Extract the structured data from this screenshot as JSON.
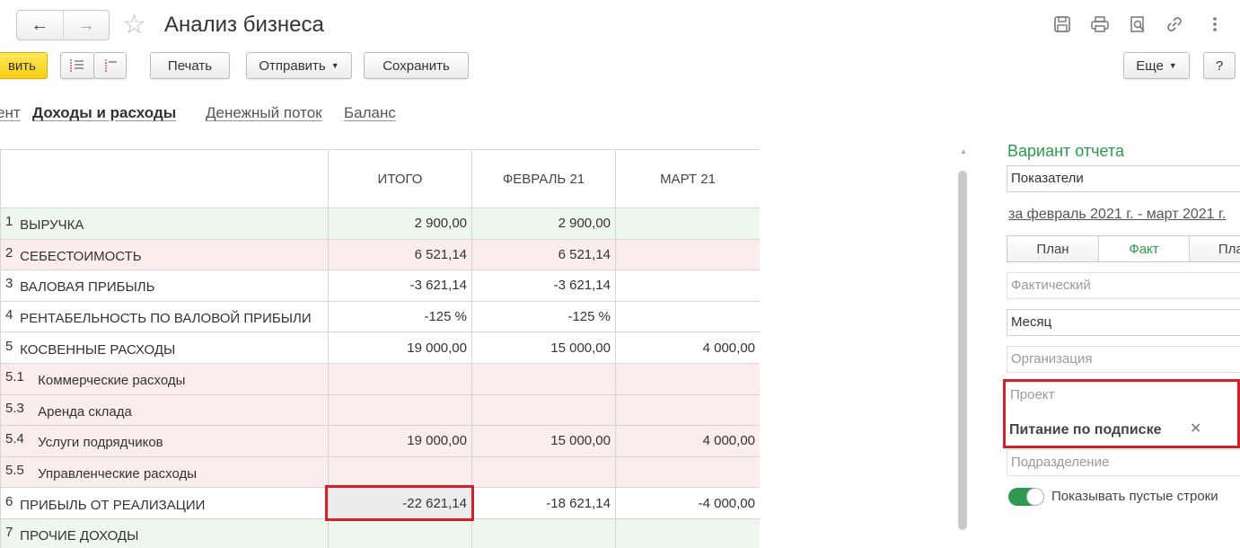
{
  "header": {
    "back_icon": "←",
    "forward_icon": "→",
    "favorite_icon": "☆",
    "title": "Анализ бизнеса"
  },
  "toolbar": {
    "primary_label": "вить",
    "print_label": "Печать",
    "send_label": "Отправить",
    "save_label": "Сохранить",
    "more_label": "Еще",
    "help_label": "?"
  },
  "tabs": [
    {
      "label": "ент"
    },
    {
      "label": "Доходы и расходы"
    },
    {
      "label": "Денежный поток"
    },
    {
      "label": "Баланс"
    }
  ],
  "table": {
    "columns": [
      "ИТОГО",
      "ФЕВРАЛЬ 21",
      "МАРТ 21"
    ],
    "rows": [
      {
        "num": "1",
        "name": "ВЫРУЧКА",
        "total": "2 900,00",
        "feb": "2 900,00",
        "mar": ""
      },
      {
        "num": "2",
        "name": "СЕБЕСТОИМОСТЬ",
        "total": "6 521,14",
        "feb": "6 521,14",
        "mar": ""
      },
      {
        "num": "3",
        "name": "ВАЛОВАЯ ПРИБЫЛЬ",
        "total": "-3 621,14",
        "feb": "-3 621,14",
        "mar": ""
      },
      {
        "num": "4",
        "name": "РЕНТАБЕЛЬНОСТЬ ПО ВАЛОВОЙ ПРИБЫЛИ",
        "total": "-125 %",
        "feb": "-125 %",
        "mar": ""
      },
      {
        "num": "5",
        "name": "КОСВЕННЫЕ РАСХОДЫ",
        "total": "19 000,00",
        "feb": "15 000,00",
        "mar": "4 000,00"
      },
      {
        "num": "5.1",
        "name": "Коммерческие расходы",
        "total": "",
        "feb": "",
        "mar": ""
      },
      {
        "num": "5.3",
        "name": "Аренда склада",
        "total": "",
        "feb": "",
        "mar": ""
      },
      {
        "num": "5.4",
        "name": "Услуги подрядчиков",
        "total": "19 000,00",
        "feb": "15 000,00",
        "mar": "4 000,00"
      },
      {
        "num": "5.5",
        "name": "Управленческие расходы",
        "total": "",
        "feb": "",
        "mar": ""
      },
      {
        "num": "6",
        "name": "ПРИБЫЛЬ ОТ РЕАЛИЗАЦИИ",
        "total": "-22 621,14",
        "feb": "-18 621,14",
        "mar": "-4 000,00"
      },
      {
        "num": "7",
        "name": "ПРОЧИЕ ДОХОДЫ",
        "total": "",
        "feb": "",
        "mar": ""
      }
    ]
  },
  "panel": {
    "title": "Вариант отчета",
    "variant_value": "Показатели",
    "period_link": "за февраль 2021 г. - март 2021 г.",
    "segments": [
      "План",
      "Факт",
      "План"
    ],
    "scenario_placeholder": "Фактический",
    "periodicity_value": "Месяц",
    "organization_placeholder": "Организация",
    "project_placeholder": "Проект",
    "project_tag": "Питание по подписке",
    "tag_remove": "✕",
    "department_placeholder": "Подразделение",
    "show_empty_label": "Показывать пустые строки"
  },
  "colors": {
    "accent_green": "#2d9a4f",
    "highlight_red": "#d5202a",
    "row_green": "#eef7ee",
    "row_pink": "#fbeded",
    "primary_yellow": "#f5cf13"
  }
}
